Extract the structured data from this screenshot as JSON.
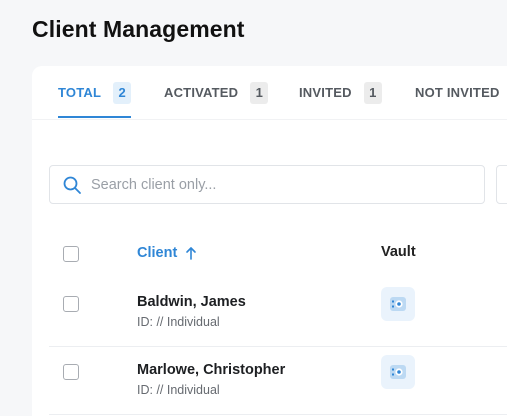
{
  "page": {
    "title": "Client Management"
  },
  "tabs": [
    {
      "label": "TOTAL",
      "count": "2",
      "active": true
    },
    {
      "label": "ACTIVATED",
      "count": "1",
      "active": false
    },
    {
      "label": "INVITED",
      "count": "1",
      "active": false
    },
    {
      "label": "NOT INVITED",
      "count": "",
      "active": false
    }
  ],
  "search": {
    "placeholder": "Search client only...",
    "value": ""
  },
  "table": {
    "columns": [
      {
        "label": "Client",
        "sort": "ascending"
      },
      {
        "label": "Vault"
      }
    ],
    "rows": [
      {
        "name": "Baldwin, James",
        "sub": "ID: // Individual",
        "vault_icon": "vault-icon"
      },
      {
        "name": "Marlowe, Christopher",
        "sub": "ID: // Individual",
        "vault_icon": "vault-icon"
      }
    ]
  },
  "colors": {
    "accent": "#2f86d6",
    "accent_bg": "#e3f0fb",
    "page_bg": "#f6f7f9",
    "card_bg": "#ffffff",
    "text_primary": "#1d1f22",
    "text_muted": "#666a70"
  },
  "icons": {
    "search": "search-icon",
    "sort": "arrow-up-icon",
    "vault": "vault-icon"
  }
}
